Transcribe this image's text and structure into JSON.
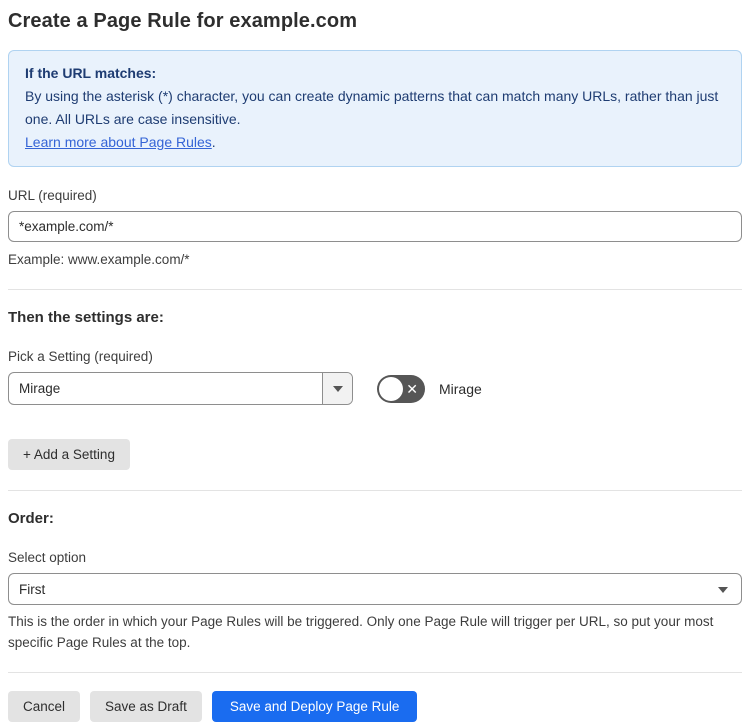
{
  "page": {
    "title": "Create a Page Rule for example.com"
  },
  "info_box": {
    "heading": "If the URL matches:",
    "body": "By using the asterisk (*) character, you can create dynamic patterns that can match many URLs, rather than just one. All URLs are case insensitive.",
    "link_label": "Learn more about Page Rules",
    "link_suffix": "."
  },
  "url_field": {
    "label": "URL (required)",
    "value": "*example.com/*",
    "helper": "Example: www.example.com/*"
  },
  "settings_section": {
    "heading": "Then the settings are:",
    "picker_label": "Pick a Setting (required)",
    "selected_setting": "Mirage",
    "toggle_label": "Mirage",
    "toggle_state": "off",
    "toggle_glyph": "✕",
    "add_setting_label": "+ Add a Setting"
  },
  "order_section": {
    "heading": "Order:",
    "select_label": "Select option",
    "selected_option": "First",
    "helper": "This is the order in which your Page Rules will be triggered. Only one Page Rule will trigger per URL, so put your most specific Page Rules at the top."
  },
  "footer": {
    "cancel_label": "Cancel",
    "save_draft_label": "Save as Draft",
    "save_deploy_label": "Save and Deploy Page Rule"
  },
  "colors": {
    "info_bg": "#e9f2fc",
    "info_border": "#b0d3f1",
    "info_text": "#1e3c72",
    "link_blue": "#3464d6",
    "primary_blue": "#1a6cf0",
    "toggle_off_bg": "#565656"
  }
}
